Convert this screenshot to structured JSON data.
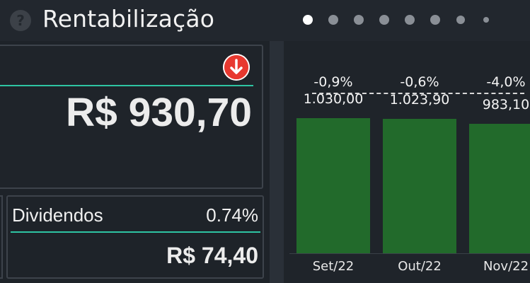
{
  "header": {
    "title": "Rentabilização",
    "help_icon": "question-circle-icon",
    "pager": {
      "total": 8,
      "active_index": 0
    }
  },
  "summary": {
    "value": "R$ 930,70",
    "trend_icon": "arrow-down-circle-icon",
    "trend_color": "#e8382f"
  },
  "dividends": {
    "label": "Dividendos",
    "percent": "0.74%",
    "value": "R$ 74,40"
  },
  "colors": {
    "accent": "#2ec4a3",
    "bar": "#226a2b"
  },
  "chart_data": {
    "type": "bar",
    "categories": [
      "Set/22",
      "Out/22",
      "Nov/22"
    ],
    "values": [
      1030.0,
      1023.9,
      983.1
    ],
    "value_labels": [
      "1.030,00",
      "1.023,90",
      "983,10"
    ],
    "change_labels": [
      "-0,9%",
      "-0,6%",
      "-4,0%"
    ],
    "ylim": [
      0,
      1400
    ],
    "grid": false
  }
}
